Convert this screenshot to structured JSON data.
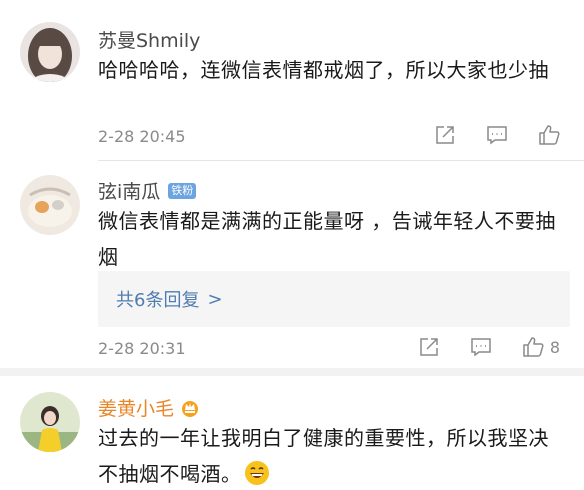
{
  "comments": [
    {
      "user": "苏曼Shmily",
      "text": "哈哈哈哈，连微信表情都戒烟了，所以大家也少抽",
      "time": "2-28 20:45",
      "actions": [
        "share-icon",
        "comment-icon",
        "like-icon"
      ]
    },
    {
      "user": "弦i南瓜",
      "badge": "铁粉",
      "text": "微信表情都是满满的正能量呀 ，告诫年轻人不要抽烟",
      "replies_label": "共6条回复",
      "replies_chevron": ">",
      "time": "2-28 20:31",
      "like_count": "8",
      "actions": [
        "share-icon",
        "comment-icon",
        "like-icon"
      ]
    },
    {
      "user": "姜黄小毛",
      "text": "过去的一年让我明白了健康的重要性，所以我坚决不抽烟不喝酒。",
      "icons": [
        "crown-badge-icon",
        "grin-emoji-icon"
      ]
    }
  ],
  "colors": {
    "name": "#4a4a4a",
    "vip_name": "#e8862a",
    "reply_link": "#507daf",
    "badge": "#6ba4e0"
  }
}
